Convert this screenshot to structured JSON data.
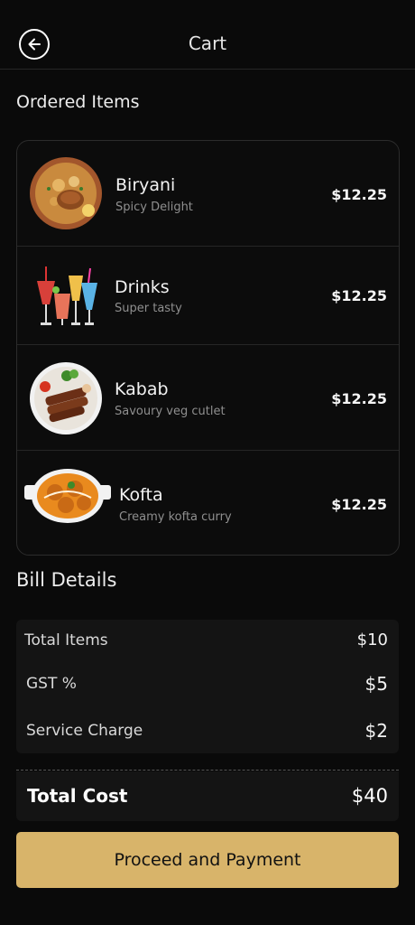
{
  "header": {
    "title": "Cart",
    "back_icon": "arrow-left-icon"
  },
  "ordered_section": {
    "title": "Ordered Items"
  },
  "items": [
    {
      "name": "Biryani",
      "description": "Spicy Delight",
      "price": "$12.25",
      "icon": "biryani-image"
    },
    {
      "name": "Drinks",
      "description": "Super tasty",
      "price": "$12.25",
      "icon": "drinks-image"
    },
    {
      "name": "Kabab",
      "description": "Savoury veg cutlet",
      "price": "$12.25",
      "icon": "kabab-image"
    },
    {
      "name": "Kofta",
      "description": "Creamy kofta curry",
      "price": "$12.25",
      "icon": "kofta-image"
    }
  ],
  "bill": {
    "title": "Bill Details",
    "rows": [
      {
        "label": "Total Items",
        "value": "$10"
      },
      {
        "label": "GST %",
        "value": "$5"
      },
      {
        "label": "Service Charge",
        "value": "$2"
      }
    ],
    "total_label": "Total Cost",
    "total_value": "$40"
  },
  "cta": {
    "label": "Proceed and Payment"
  },
  "colors": {
    "background": "#0a0a0a",
    "card": "#141414",
    "accent": "#d8b46a"
  }
}
